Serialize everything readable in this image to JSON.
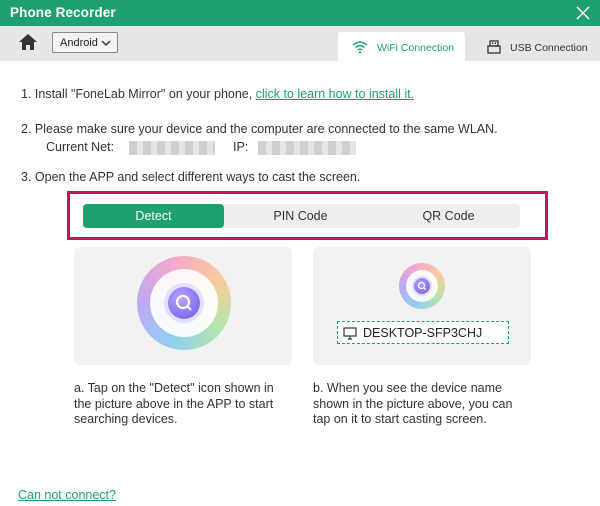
{
  "window": {
    "title": "Phone Recorder"
  },
  "toolbar": {
    "platform_selected": "Android",
    "tabs": [
      {
        "label": "WiFi Connection",
        "icon": "wifi-icon",
        "active": true
      },
      {
        "label": "USB Connection",
        "icon": "usb-icon",
        "active": false
      }
    ]
  },
  "steps": {
    "step1_text": "1. Install \"FoneLab Mirror\" on your phone, ",
    "step1_link": "click to learn how to install it.",
    "step2_text": "2. Please make sure your device and the computer are connected to the same WLAN.",
    "current_net_label": "Current Net:",
    "ip_label": "IP:",
    "step3_text": "3. Open the APP and select different ways to cast the screen."
  },
  "modes": [
    {
      "label": "Detect",
      "active": true
    },
    {
      "label": "PIN Code",
      "active": false
    },
    {
      "label": "QR Code",
      "active": false
    }
  ],
  "cards": {
    "device_name": "DESKTOP-SFP3CHJ",
    "desc_a": "a. Tap on the \"Detect\" icon shown in the picture above in the APP to start searching devices.",
    "desc_b": "b. When you see the device name shown in the picture above, you can tap on it to start casting screen."
  },
  "footer": {
    "cannot_connect": "Can not connect?"
  },
  "colors": {
    "accent": "#1ea16e",
    "highlight": "#c2185b"
  }
}
